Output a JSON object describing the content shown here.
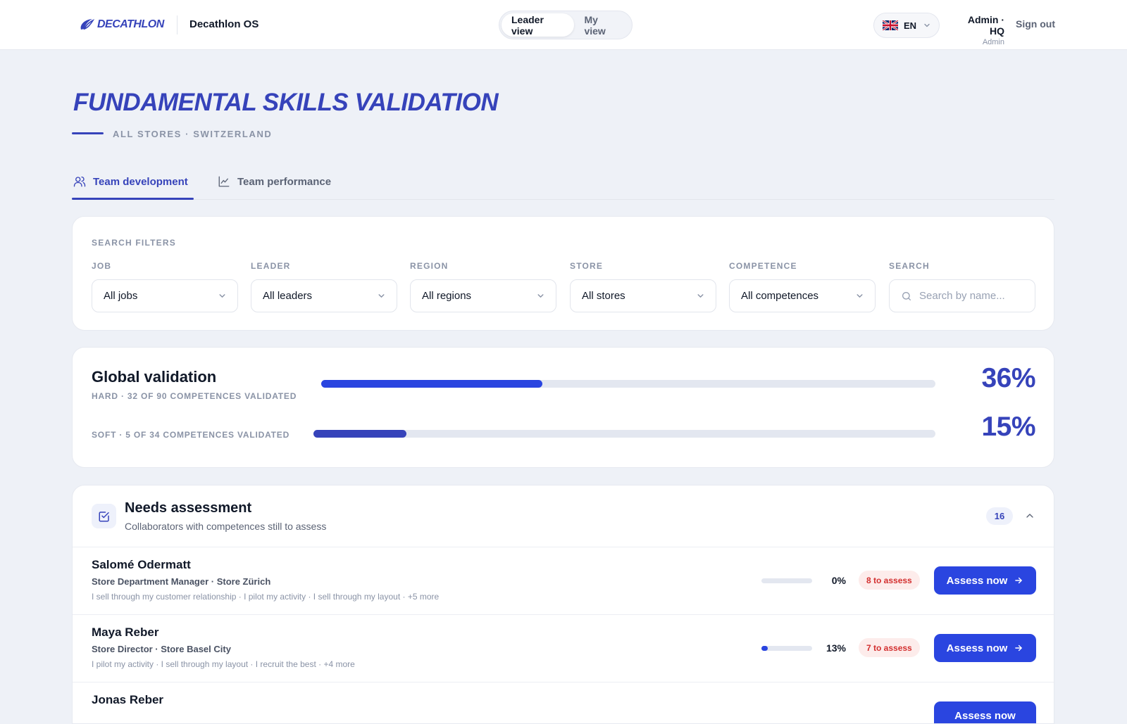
{
  "header": {
    "brand": "DECATHLON",
    "app_name": "Decathlon OS",
    "view_toggle": [
      "Leader view",
      "My view"
    ],
    "active_view": "Leader view",
    "language": "EN",
    "user_name": "Admin · HQ",
    "user_role": "Admin",
    "sign_out": "Sign out"
  },
  "page": {
    "title": "FUNDAMENTAL SKILLS VALIDATION",
    "subtitle": "ALL STORES · SWITZERLAND"
  },
  "tabs": [
    {
      "label": "Team development",
      "icon": "users-icon",
      "active": true
    },
    {
      "label": "Team performance",
      "icon": "line-chart-icon",
      "active": false
    }
  ],
  "filters": {
    "section_label": "SEARCH FILTERS",
    "items": [
      {
        "label": "JOB",
        "value": "All jobs"
      },
      {
        "label": "LEADER",
        "value": "All leaders"
      },
      {
        "label": "REGION",
        "value": "All regions"
      },
      {
        "label": "STORE",
        "value": "All stores"
      },
      {
        "label": "COMPETENCE",
        "value": "All competences"
      }
    ],
    "search_label": "SEARCH",
    "search_placeholder": "Search by name..."
  },
  "global_validation": {
    "title": "Global validation",
    "hard": {
      "caption": "HARD · 32 OF 90 COMPETENCES VALIDATED",
      "percent_label": "36%",
      "fraction": 0.36,
      "color": "#2a45e0"
    },
    "soft": {
      "caption": "SOFT · 5 OF 34 COMPETENCES VALIDATED",
      "percent_label": "15%",
      "fraction": 0.15,
      "color": "#3643ba"
    }
  },
  "needs_assessment": {
    "title": "Needs assessment",
    "subtitle": "Collaborators with competences still to assess",
    "count": "16",
    "rows": [
      {
        "name": "Salomé Odermatt",
        "job": "Store Department Manager · Store Zürich",
        "competences": "I sell through my customer relationship · I pilot my activity · I sell through my layout · +5 more",
        "percent_label": "0%",
        "fraction": 0.0,
        "badge": "8 to assess",
        "button": "Assess now"
      },
      {
        "name": "Maya Reber",
        "job": "Store Director · Store Basel City",
        "competences": "I pilot my activity · I sell through my layout · I recruit the best · +4 more",
        "percent_label": "13%",
        "fraction": 0.13,
        "badge": "7 to assess",
        "button": "Assess now"
      },
      {
        "name": "Jonas Reber",
        "job": "",
        "competences": "",
        "percent_label": "",
        "fraction": 0.0,
        "badge": "",
        "button": "Assess now"
      }
    ]
  },
  "colors": {
    "brand": "#3643ba",
    "primary": "#2a45e0",
    "danger": "#d32f2f"
  }
}
